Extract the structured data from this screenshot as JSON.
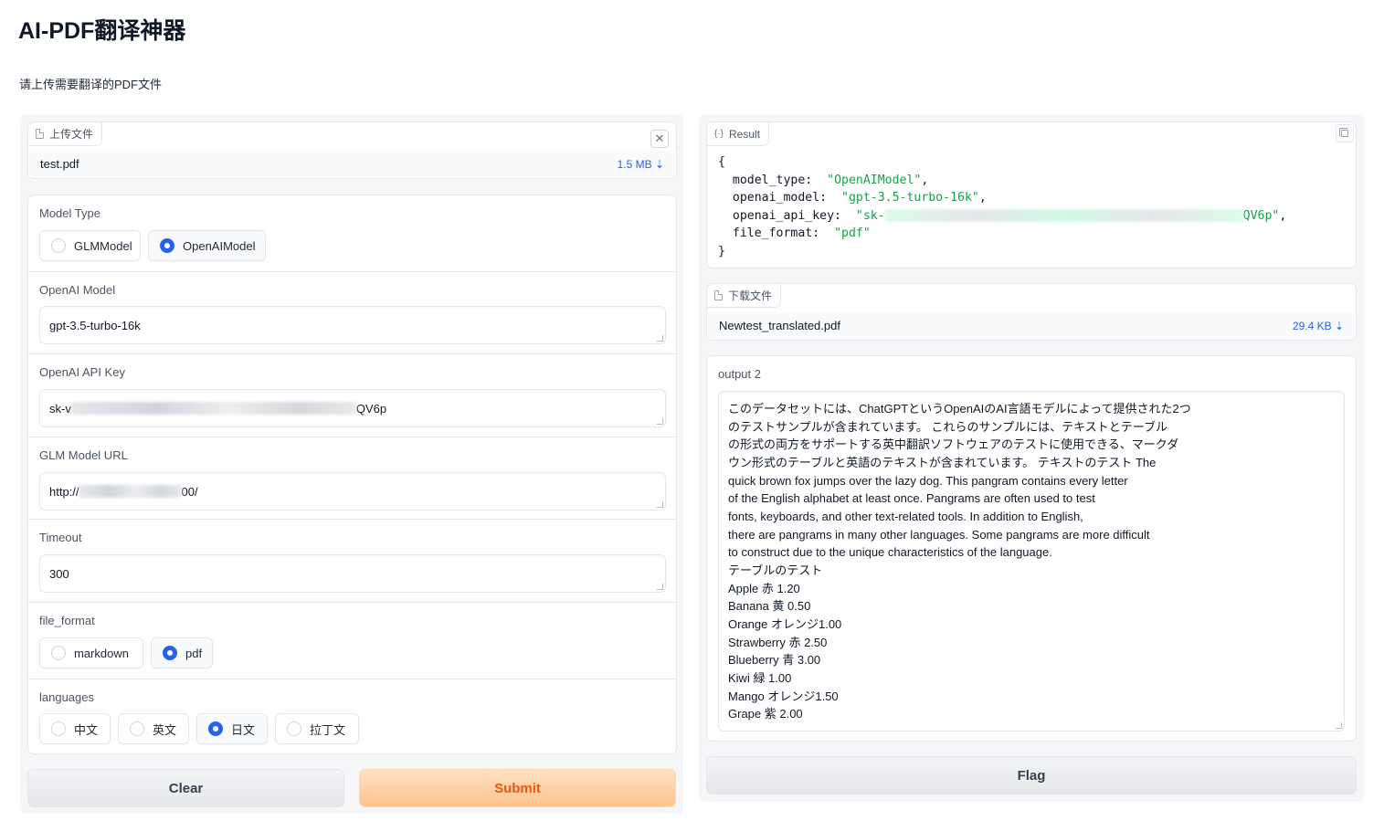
{
  "page": {
    "title": "AI-PDF翻译神器",
    "subtitle": "请上传需要翻译的PDF文件"
  },
  "upload": {
    "label": "上传文件",
    "file_name": "test.pdf",
    "file_size": "1.5 MB ⇣",
    "close_icon": "close-icon"
  },
  "model_type": {
    "label": "Model Type",
    "options": [
      "GLMModel",
      "OpenAIModel"
    ],
    "selected": "OpenAIModel"
  },
  "openai_model": {
    "label": "OpenAI Model",
    "value": "gpt-3.5-turbo-16k"
  },
  "openai_api_key": {
    "label": "OpenAI API Key",
    "value_prefix": "sk-v",
    "value_suffix": "QV6p"
  },
  "glm_model_url": {
    "label": "GLM Model URL",
    "value_prefix": "http://",
    "value_suffix": "00/"
  },
  "timeout": {
    "label": "Timeout",
    "value": "300"
  },
  "file_format": {
    "label": "file_format",
    "options": [
      "markdown",
      "pdf"
    ],
    "selected": "pdf"
  },
  "languages": {
    "label": "languages",
    "options": [
      "中文",
      "英文",
      "日文",
      "拉丁文"
    ],
    "selected": "日文"
  },
  "buttons": {
    "clear": "Clear",
    "submit": "Submit",
    "flag": "Flag"
  },
  "result": {
    "label": "Result",
    "open_brace": "{",
    "close_brace": "}",
    "model_type_key": "model_type:",
    "model_type_val": "\"OpenAIModel\"",
    "openai_model_key": "openai_model:",
    "openai_model_val": "\"gpt-3.5-turbo-16k\"",
    "api_key_key": "openai_api_key:",
    "api_key_val_prefix": "\"sk-",
    "api_key_val_suffix": "QV6p\"",
    "file_format_key": "file_format:",
    "file_format_val": "\"pdf\""
  },
  "download": {
    "label": "下载文件",
    "file_name": "Newtest_translated.pdf",
    "file_size": "29.4 KB ⇣"
  },
  "output2": {
    "label": "output 2",
    "lines": [
      "このデータセットには、ChatGPTというOpenAIのAI言語モデルによって提供された2つ",
      "のテストサンプルが含まれています。 これらのサンプルには、テキストとテーブル",
      "の形式の両方をサポートする英中翻訳ソフトウェアのテストに使用できる、マークダ",
      "ウン形式のテーブルと英語のテキストが含まれています。 テキストのテスト The",
      "quick brown fox jumps over the lazy dog. This pangram contains every letter",
      "of the English alphabet at least once. Pangrams are often used to test",
      "fonts, keyboards, and other text-related tools. In addition to English,",
      "there are pangrams in many other languages. Some pangrams are more difficult",
      "to construct due to the unique characteristics of the language.",
      "テーブルのテスト",
      "Apple 赤 1.20",
      "Banana 黄 0.50",
      "Orange オレンジ1.00",
      "Strawberry 赤 2.50",
      "Blueberry 青 3.00",
      "Kiwi 緑 1.00",
      "Mango オレンジ1.50",
      "Grape 紫 2.00"
    ]
  },
  "colors": {
    "accent": "#2563eb",
    "submit_text": "#ea580c",
    "json_string": "#16a34a"
  }
}
